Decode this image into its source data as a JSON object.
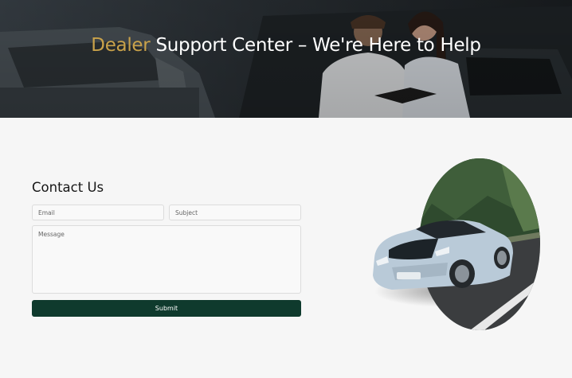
{
  "hero": {
    "title_accent": "Dealer",
    "title_rest": " Support Center – We're Here to Help"
  },
  "contact": {
    "heading": "Contact Us",
    "email_placeholder": "Email",
    "subject_placeholder": "Subject",
    "message_placeholder": "Message",
    "submit_label": "Submit"
  },
  "colors": {
    "accent": "#c9a24a",
    "button": "#0f3a2d",
    "page_background": "#f6f6f6"
  }
}
